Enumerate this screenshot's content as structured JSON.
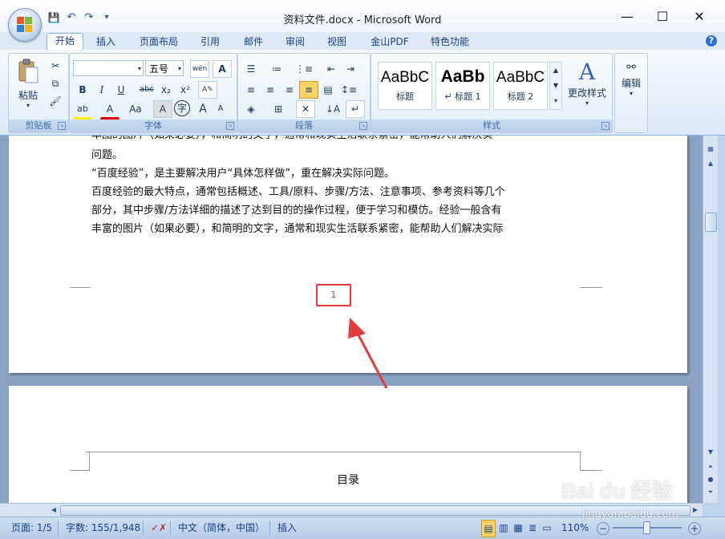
{
  "window": {
    "title": "资料文件.docx - Microsoft Word",
    "minimize": "—",
    "maximize": "☐",
    "close": "✕"
  },
  "qat": {
    "save": "💾",
    "undo": "↶",
    "redo": "↷",
    "customize": "▾"
  },
  "tabs": [
    "开始",
    "插入",
    "页面布局",
    "引用",
    "邮件",
    "审阅",
    "视图",
    "金山PDF",
    "特色功能"
  ],
  "help": "?",
  "clipboard": {
    "paste_label": "粘贴",
    "group_label": "剪贴板"
  },
  "font": {
    "name_value": "",
    "size_value": "五号",
    "phonetic_label": "wén",
    "group_label": "字体",
    "bold": "B",
    "italic": "I",
    "underline": "U",
    "strike": "abc",
    "subscript": "x₂",
    "superscript": "x²",
    "highlight": "ab",
    "fontcolor": "A",
    "case": "Aa",
    "charshade": "A",
    "enclose": "字",
    "grow": "A",
    "shrink": "A"
  },
  "paragraph": {
    "group_label": "段落"
  },
  "styles": {
    "group_label": "样式",
    "items": [
      {
        "sample": "AaBbC",
        "name": "标题"
      },
      {
        "sample": "AaBb",
        "name": "↵ 标题 1"
      },
      {
        "sample": "AaBbC",
        "name": "标题 2"
      }
    ],
    "change_label": "更改样式"
  },
  "editing": {
    "label": "编辑"
  },
  "document": {
    "page1_lines": [
      "问题。",
      "“百度经验”，是主要解决用户“具体怎样做”，重在解决实际问题。",
      "百度经验的最大特点，通常包括概述、工具/原料、步骤/方法、注意事项、参考资料等几个",
      "部分，其中步骤/方法详细的描述了达到目的的操作过程，便于学习和模仿。经验一般含有",
      "丰富的图片（如果必要），和简明的文字，通常和现实生活联系紧密，能帮助人们解决实际"
    ],
    "page_number": "1",
    "page2_heading": "目录"
  },
  "statusbar": {
    "page": "页面: 1/5",
    "words": "字数: 155/1,948",
    "language": "中文（简体，中国）",
    "insert_mode": "插入",
    "zoom": "110%",
    "zoom_out": "−",
    "zoom_in": "+"
  },
  "watermark": {
    "brand": "Bai du 经验",
    "url": "jingyan.baidu.com"
  },
  "colors": {
    "accent": "#2b5797",
    "annotation": "#e23c3c"
  }
}
